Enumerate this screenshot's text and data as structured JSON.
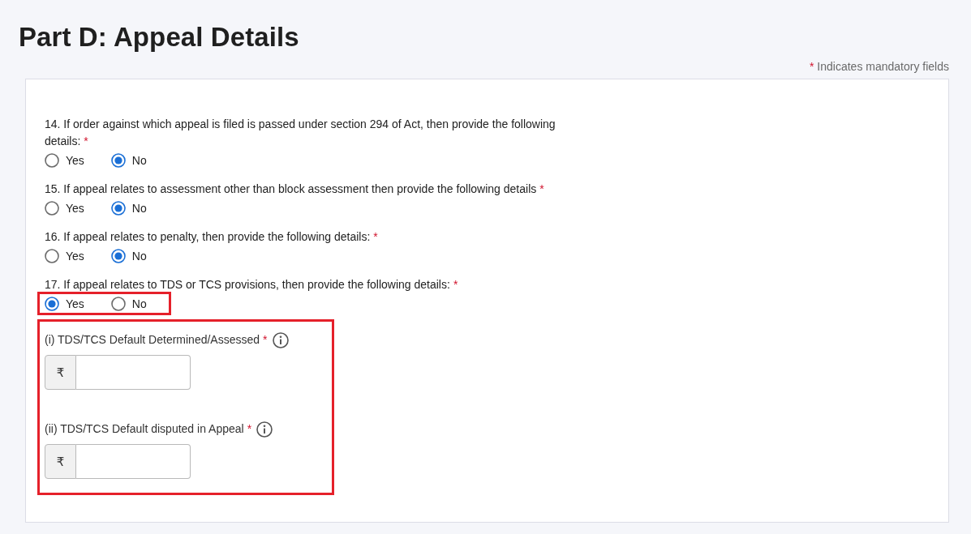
{
  "page": {
    "title": "Part D: Appeal Details",
    "mandatory_note": {
      "marker": "*",
      "text": "Indicates mandatory fields"
    }
  },
  "questions": [
    {
      "text": "14. If order against which appeal is filed is passed under section 294 of Act, then provide the following details:",
      "required_marker": "*",
      "options": [
        {
          "label": "Yes",
          "selected": false
        },
        {
          "label": "No",
          "selected": true
        }
      ],
      "options_highlighted": false
    },
    {
      "text": "15. If appeal relates to assessment other than block assessment then provide the following details",
      "required_marker": "*",
      "options": [
        {
          "label": "Yes",
          "selected": false
        },
        {
          "label": "No",
          "selected": true
        }
      ],
      "options_highlighted": false
    },
    {
      "text": "16. If appeal relates to penalty, then provide the following details:",
      "required_marker": "*",
      "options": [
        {
          "label": "Yes",
          "selected": false
        },
        {
          "label": "No",
          "selected": true
        }
      ],
      "options_highlighted": false
    },
    {
      "text": "17. If appeal relates to TDS or TCS provisions, then provide the following details:",
      "required_marker": "*",
      "options": [
        {
          "label": "Yes",
          "selected": true
        },
        {
          "label": "No",
          "selected": false
        }
      ],
      "options_highlighted": true,
      "details": {
        "highlighted": true,
        "fields": [
          {
            "label": "(i) TDS/TCS Default Determined/Assessed",
            "required_marker": "*",
            "prefix": "₹"
          },
          {
            "label": "(ii) TDS/TCS Default disputed in Appeal",
            "required_marker": "*",
            "prefix": "₹"
          }
        ]
      }
    }
  ]
}
